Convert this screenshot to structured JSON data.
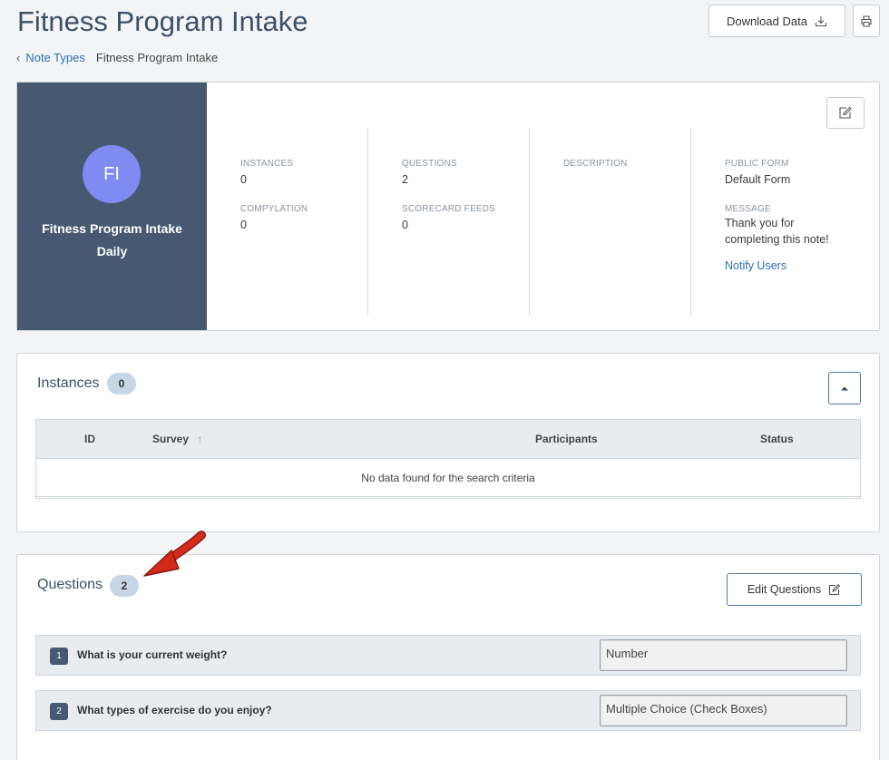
{
  "header": {
    "title": "Fitness Program Intake",
    "download_label": "Download Data"
  },
  "breadcrumb": {
    "parent": "Note Types",
    "current": "Fitness Program Intake"
  },
  "summary": {
    "initials": "FI",
    "name": "Fitness Program Intake",
    "frequency": "Daily",
    "instances_label": "INSTANCES",
    "instances_value": "0",
    "compylation_label": "COMPYLATION",
    "compylation_value": "0",
    "questions_label": "QUESTIONS",
    "questions_value": "2",
    "scorecard_label": "SCORECARD FEEDS",
    "scorecard_value": "0",
    "description_label": "DESCRIPTION",
    "public_form_label": "PUBLIC FORM",
    "public_form_value": "Default Form",
    "message_label": "MESSAGE",
    "message_line1": "Thank you for",
    "message_line2": "completing this note!",
    "notify_label": "Notify Users"
  },
  "instances": {
    "title": "Instances",
    "count": "0",
    "columns": [
      "ID",
      "Survey",
      "Participants",
      "Status"
    ],
    "sort_indicator": "↑",
    "empty_message": "No data found for the search criteria"
  },
  "questions": {
    "title": "Questions",
    "count": "2",
    "edit_label": "Edit Questions",
    "items": [
      {
        "number": "1",
        "text": "What is your current weight?",
        "type": "Number"
      },
      {
        "number": "2",
        "text": "What types of exercise do you enjoy?",
        "type": "Multiple Choice (Check Boxes)"
      }
    ]
  },
  "colors": {
    "title": "#3d5066",
    "sidebar": "#475871",
    "avatar": "#7f8af3",
    "link": "#2f6fb3",
    "badge": "#c7d6e6",
    "arrow": "#d42a1c"
  },
  "icons": [
    "download-icon",
    "print-icon",
    "chevron-left-icon",
    "edit-icon",
    "caret-up-icon",
    "sort-up-icon",
    "annotation-arrow"
  ]
}
